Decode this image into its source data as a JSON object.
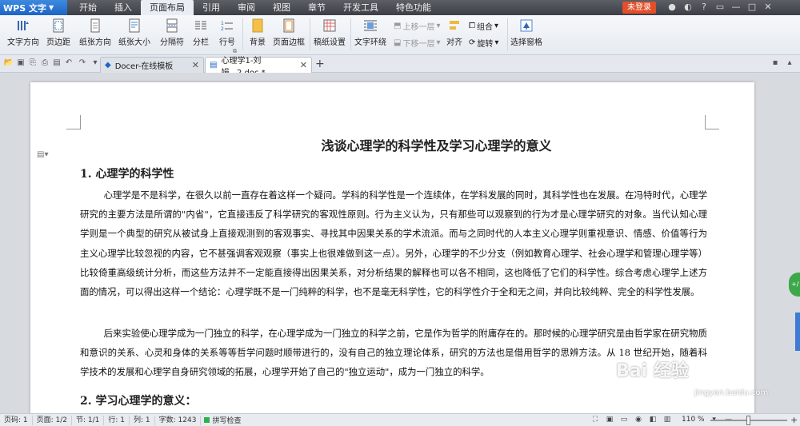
{
  "app": {
    "name": "WPS 文字"
  },
  "menu": {
    "tabs": [
      "开始",
      "插入",
      "页面布局",
      "引用",
      "审阅",
      "视图",
      "章节",
      "开发工具",
      "特色功能"
    ],
    "active_index": 2,
    "login_label": "未登录"
  },
  "ribbon": {
    "text_direction": "文字方向",
    "margins": "页边距",
    "orientation": "纸张方向",
    "paper_size": "纸张大小",
    "separator": "分隔符",
    "columns": "分栏",
    "line_number": "行号",
    "background": "背景",
    "page_border": "页面边框",
    "draft_settings": "稿纸设置",
    "text_wrap": "文字环绕",
    "bring_forward": "上移一层",
    "send_backward": "下移一层",
    "align": "对齐",
    "group": "组合",
    "rotate": "旋转",
    "selection_pane": "选择窗格"
  },
  "doc_tabs": [
    {
      "label": "Docer-在线模板",
      "active": false
    },
    {
      "label": "心理学1-刘娟...2.doc *",
      "active": true
    }
  ],
  "document": {
    "title": "浅谈心理学的科学性及学习心理学的意义",
    "heading1": "1. 心理学的科学性",
    "para1": "心理学是不是科学，在很久以前一直存在着这样一个疑问。学科的科学性是一个连续体，在学科发展的同时，其科学性也在发展。在冯特时代，心理学研究的主要方法是所谓的\"内省\"，它直接违反了科学研究的客观性原则。行为主义认为，只有那些可以观察到的行为才是心理学研究的对象。当代认知心理学则是一个典型的研究从被试身上直接观测到的客观事实、寻找其中因果关系的学术流派。而与之同时代的人本主义心理学则重视意识、情感、价值等行为主义心理学比较忽视的内容，它不甚强调客观观察（事实上也很难做到这一点）。另外，心理学的不少分支（例如教育心理学、社会心理学和管理心理学等）比较倚重高级统计分析，而这些方法并不一定能直接得出因果关系，对分析结果的解释也可以各不相同，这也降低了它们的科学性。综合考虑心理学上述方面的情况，可以得出这样一个结论：心理学既不是一门纯粹的科学，也不是毫无科学性，它的科学性介于全和无之间，并向比较纯粹、完全的科学性发展。",
    "para2": "后来实验使心理学成为一门独立的科学，在心理学成为一门独立的科学之前，它是作为哲学的附庸存在的。那时候的心理学研究是由哲学家在研究物质和意识的关系、心灵和身体的关系等等哲学问题时顺带进行的，没有自己的独立理论体系，研究的方法也是借用哲学的思辨方法。从 18 世纪开始，随着科学技术的发展和心理学自身研究领域的拓展，心理学开始了自己的\"独立运动\"，成为一门独立的科学。",
    "heading2": "2. 学习心理学的意义："
  },
  "watermark": {
    "text": "Bai 经验",
    "url": "jingyan.baidu.com"
  },
  "status": {
    "page_num": "页码: 1",
    "pages": "页面: 1/2",
    "section": "节: 1/1",
    "line": "行: 1",
    "column": "列: 1",
    "word_count": "字数: 1243",
    "spell_check": "拼写检查",
    "zoom": "110 %"
  },
  "colors": {
    "accent": "#3d8ae0",
    "login": "#e1502b",
    "spell_ok": "#2bb24c"
  }
}
